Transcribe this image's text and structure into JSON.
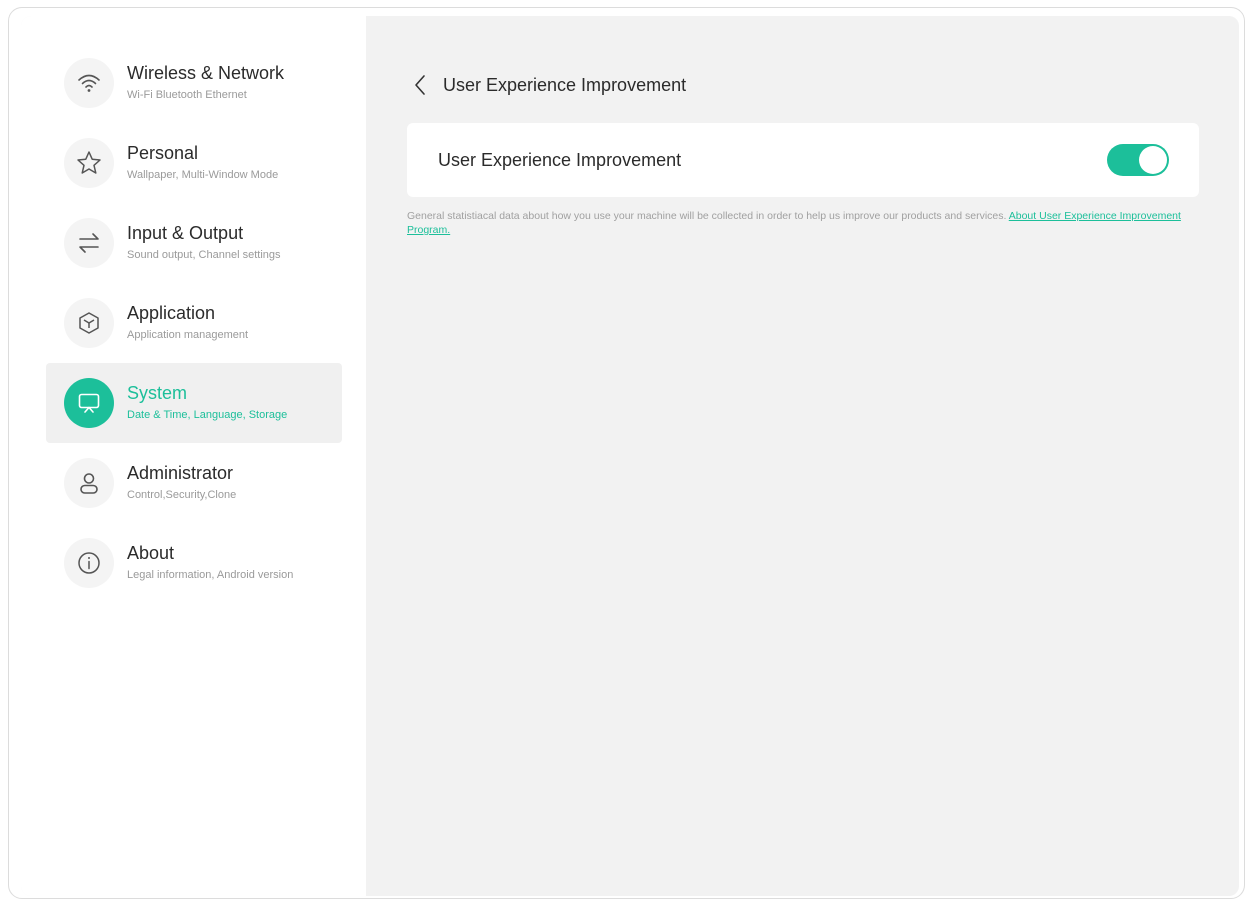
{
  "sidebar": {
    "items": [
      {
        "title": "Wireless & Network",
        "subtitle": "Wi-Fi Bluetooth Ethernet",
        "icon": "wifi-icon"
      },
      {
        "title": "Personal",
        "subtitle": "Wallpaper, Multi-Window Mode",
        "icon": "star-icon"
      },
      {
        "title": "Input & Output",
        "subtitle": "Sound output, Channel settings",
        "icon": "arrows-swap-icon"
      },
      {
        "title": "Application",
        "subtitle": "Application management",
        "icon": "cube-icon"
      },
      {
        "title": "System",
        "subtitle": "Date & Time, Language, Storage",
        "icon": "presentation-screen-icon",
        "active": true
      },
      {
        "title": "Administrator",
        "subtitle": "Control,Security,Clone",
        "icon": "user-icon"
      },
      {
        "title": "About",
        "subtitle": "Legal information, Android version",
        "icon": "info-icon"
      }
    ]
  },
  "header": {
    "title": "User Experience Improvement",
    "back_icon": "chevron-left-icon"
  },
  "setting": {
    "label": "User Experience Improvement",
    "enabled": true
  },
  "description": {
    "text": "General statistiacal data about how you use your machine will be collected in order to help us improve our products and services.",
    "link": "About User Experience Improvement Program."
  },
  "colors": {
    "accent": "#1cbf9a",
    "panel_bg": "#f2f2f2",
    "sidebar_bg": "#ffffff",
    "text_primary": "#2b2b2b",
    "text_secondary": "#9a9a9a"
  }
}
